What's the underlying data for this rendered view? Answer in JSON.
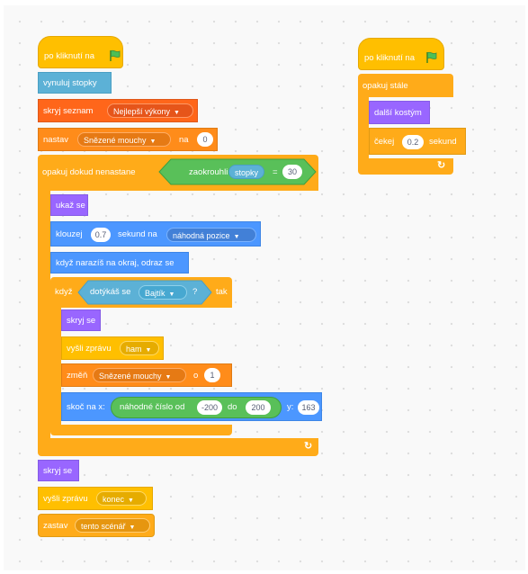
{
  "script1": {
    "hat": "po kliknutí na",
    "reset_timer": "vynuluj stopky",
    "hide_list": "skryj seznam",
    "hide_list_value": "Nejlepší výkony",
    "set_var": "nastav",
    "set_var_name": "Snězené mouchy",
    "set_var_to": "na",
    "set_var_value": "0",
    "repeat_until": "opakuj dokud nenastane",
    "round_op": "zaokrouhli",
    "timer_reporter": "stopky",
    "equals": "=",
    "equals_value": "30",
    "show": "ukaž se",
    "glide": "klouzej",
    "glide_secs": "0.7",
    "glide_mid": "sekund na",
    "glide_target": "náhodná pozice",
    "bounce": "když narazíš na okraj, odraz se",
    "if_label": "když",
    "touching": "dotýkáš se",
    "touching_target": "Bajtík",
    "touching_q": "?",
    "then_label": "tak",
    "hide": "skryj se",
    "broadcast": "vyšli zprávu",
    "broadcast_msg": "ham",
    "change_var": "změň",
    "change_var_name": "Snězené mouchy",
    "change_by": "o",
    "change_value": "1",
    "goto_xy": "skoč na x:",
    "random": "náhodné číslo od",
    "random_from": "-200",
    "random_to_label": "do",
    "random_to": "200",
    "y_label": "y:",
    "y_value": "163",
    "hide_end": "skryj se",
    "broadcast_end": "vyšli zprávu",
    "broadcast_end_msg": "konec",
    "stop": "zastav",
    "stop_option": "tento scénář"
  },
  "script2": {
    "hat": "po kliknutí na",
    "forever": "opakuj stále",
    "next_costume": "další kostým",
    "wait": "čekej",
    "wait_value": "0.2",
    "wait_unit": "sekund"
  },
  "icons": {
    "flag": "green-flag-icon",
    "loop_arrow": "loop-arrow-icon",
    "dropdown": "dropdown-arrow-icon"
  },
  "colors": {
    "events": "#ffbf00",
    "control": "#ffab19",
    "motion": "#4c97ff",
    "looks": "#9966ff",
    "variables": "#ff8c1a",
    "lists": "#ff661a",
    "operators": "#59c059",
    "sensing": "#5cb1d6"
  }
}
